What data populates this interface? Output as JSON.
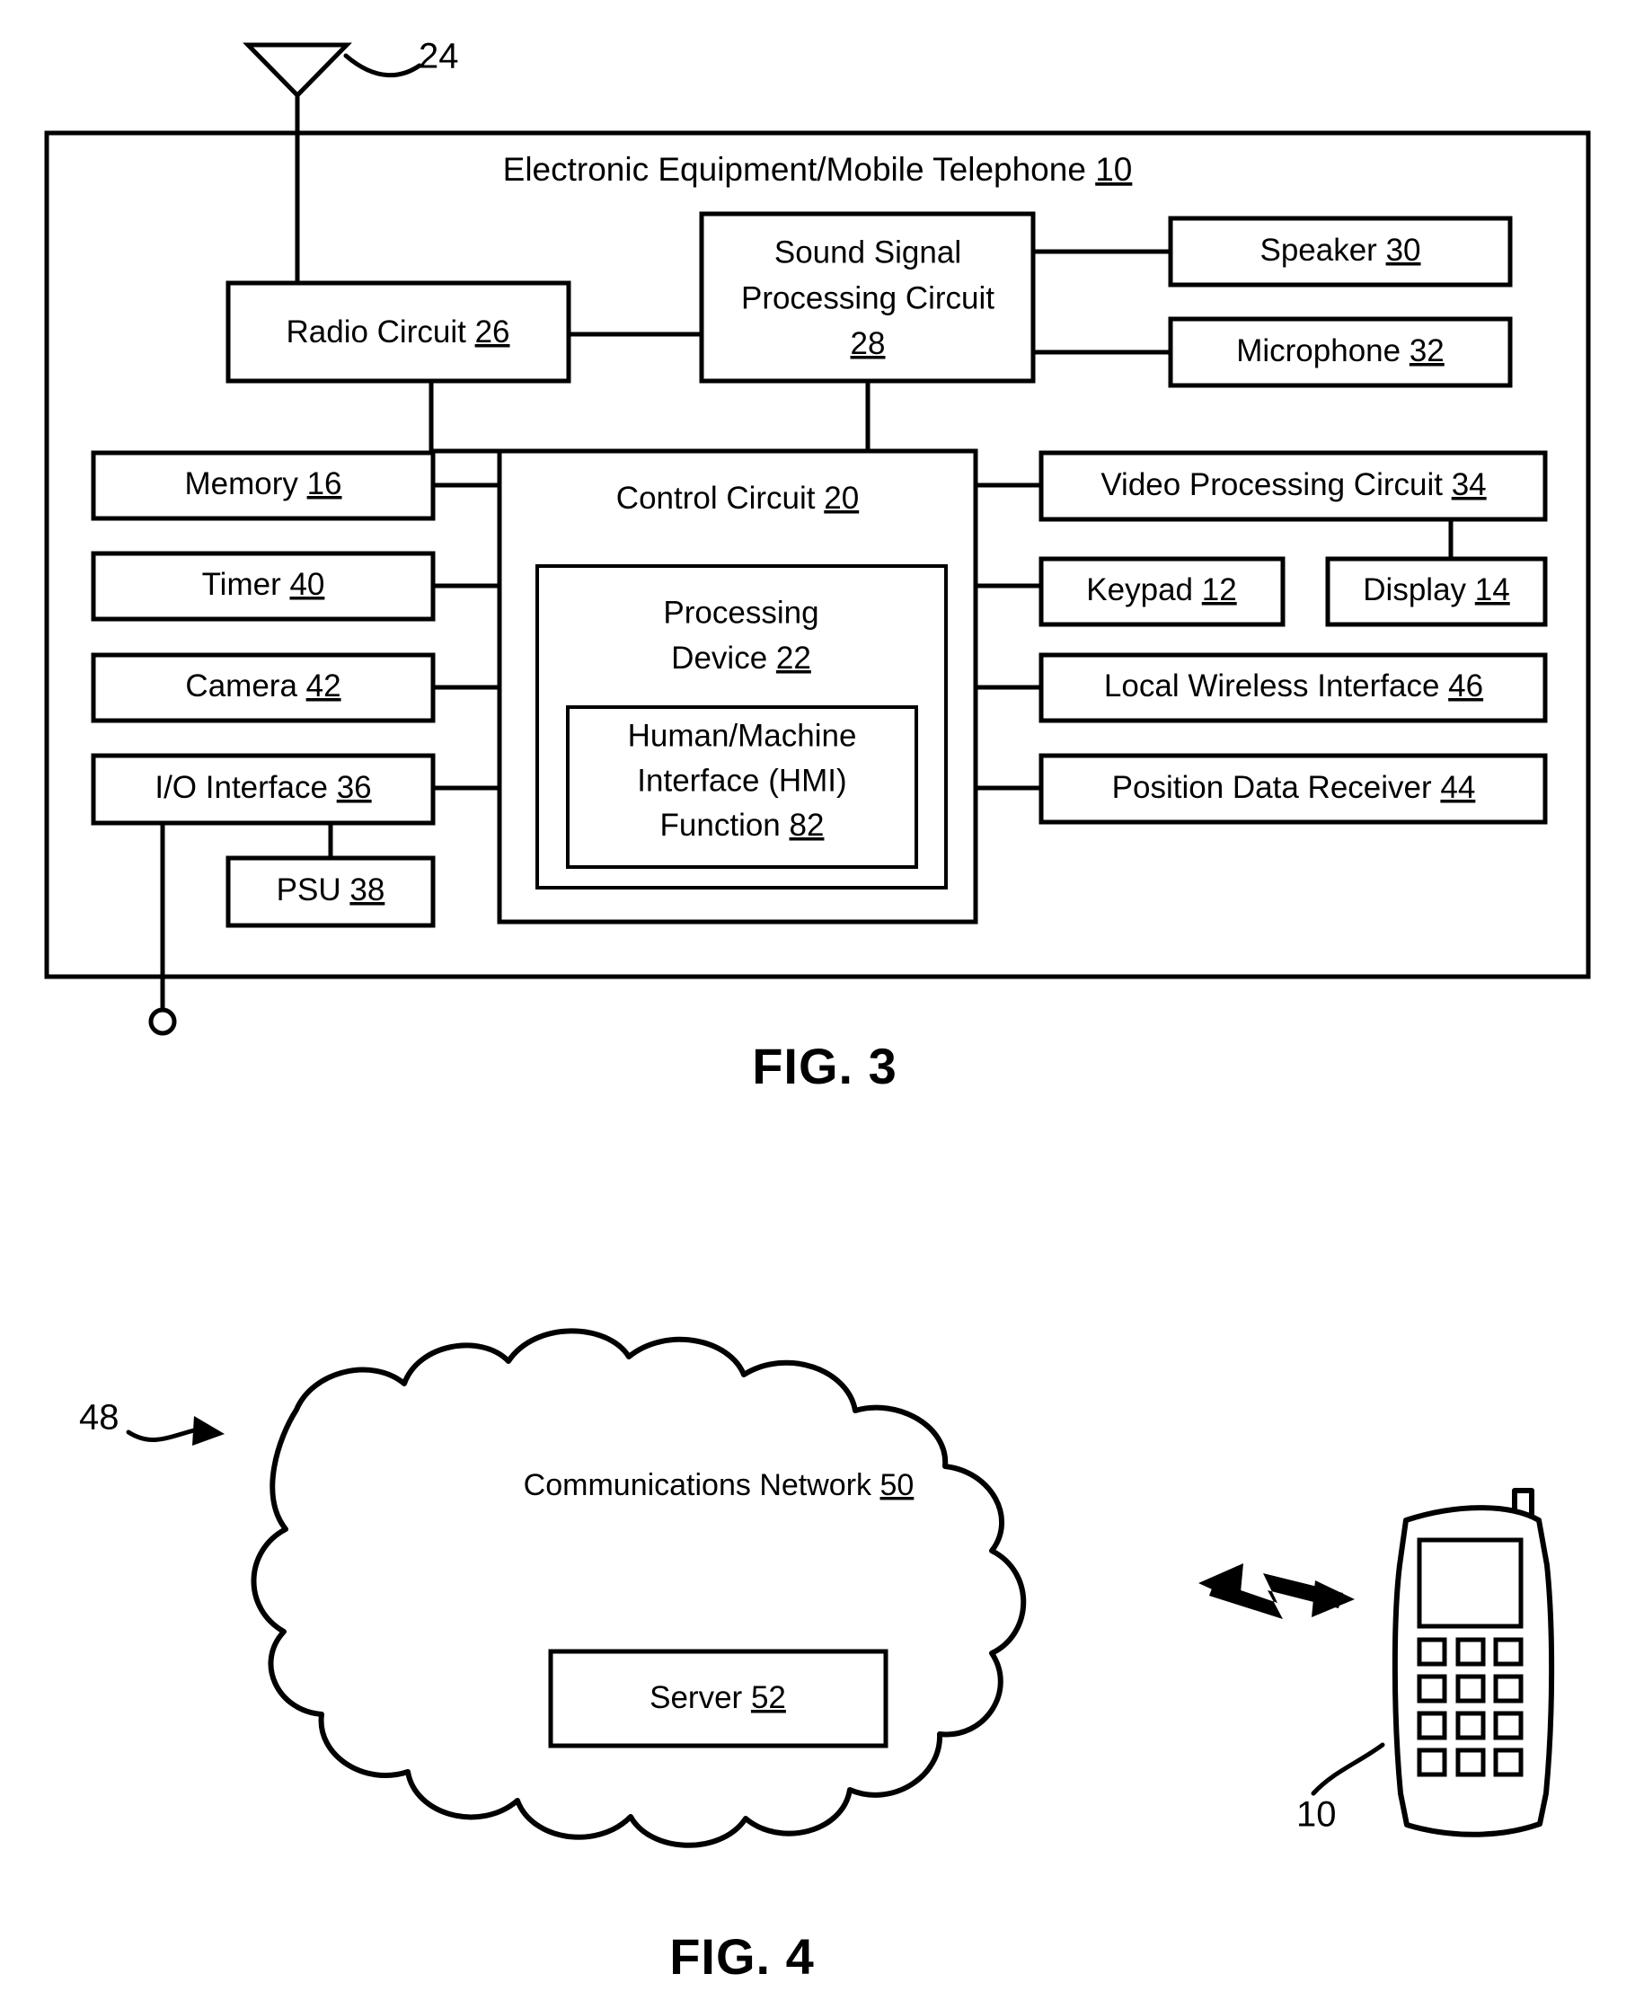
{
  "figures": [
    {
      "id": "fig3",
      "caption": "FIG. 3",
      "title": "Electronic Equipment/Mobile Telephone",
      "title_ref": "10",
      "antenna_ref": "24",
      "blocks": [
        {
          "key": "radio_circuit",
          "label": "Radio Circuit",
          "ref": "26"
        },
        {
          "key": "sound_signal",
          "label": "Sound Signal Processing Circuit",
          "ref": "28"
        },
        {
          "key": "speaker",
          "label": "Speaker",
          "ref": "30"
        },
        {
          "key": "microphone",
          "label": "Microphone",
          "ref": "32"
        },
        {
          "key": "memory",
          "label": "Memory",
          "ref": "16"
        },
        {
          "key": "timer",
          "label": "Timer",
          "ref": "40"
        },
        {
          "key": "camera",
          "label": "Camera",
          "ref": "42"
        },
        {
          "key": "io_interface",
          "label": "I/O Interface",
          "ref": "36"
        },
        {
          "key": "psu",
          "label": "PSU",
          "ref": "38"
        },
        {
          "key": "control_circuit",
          "label": "Control Circuit",
          "ref": "20"
        },
        {
          "key": "processing_device",
          "label": "Processing Device",
          "ref": "22"
        },
        {
          "key": "hmi_function",
          "label": "Human/Machine Interface (HMI) Function",
          "ref": "82"
        },
        {
          "key": "video_processing",
          "label": "Video Processing Circuit",
          "ref": "34"
        },
        {
          "key": "keypad",
          "label": "Keypad",
          "ref": "12"
        },
        {
          "key": "display",
          "label": "Display",
          "ref": "14"
        },
        {
          "key": "local_wireless",
          "label": "Local Wireless Interface",
          "ref": "46"
        },
        {
          "key": "position_receiver",
          "label": "Position Data Receiver",
          "ref": "44"
        }
      ],
      "labels": {
        "sound_signal_line1": "Sound Signal",
        "sound_signal_line2": "Processing Circuit",
        "processing_device_line1": "Processing",
        "processing_device_line2": "Device",
        "hmi_line1": "Human/Machine",
        "hmi_line2": "Interface (HMI)",
        "hmi_line3": "Function"
      }
    },
    {
      "id": "fig4",
      "caption": "FIG. 4",
      "system_ref": "48",
      "cloud_label": "Communications Network",
      "cloud_ref": "50",
      "server_label": "Server",
      "server_ref": "52",
      "phone_ref": "10"
    }
  ]
}
